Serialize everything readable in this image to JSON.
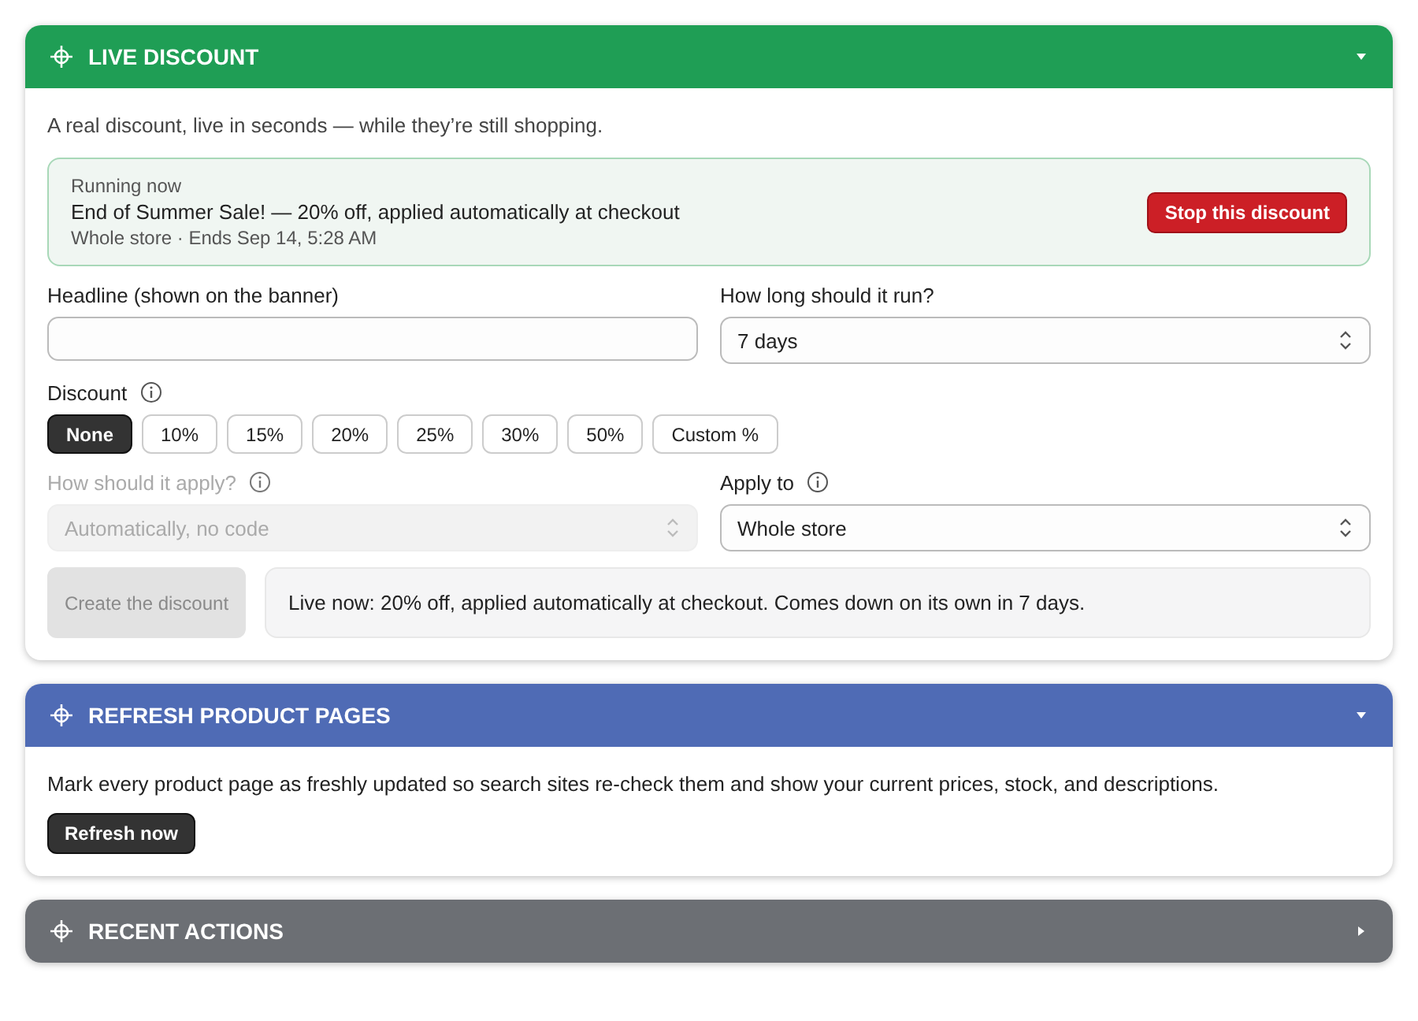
{
  "panels": [
    {
      "kind": "discount",
      "title": "LIVE DISCOUNT",
      "color": "#1f9e55",
      "expanded": true,
      "intro": "A real discount, live in seconds — while they’re still shopping.",
      "running": {
        "label": "Running now",
        "title": "End of Summer Sale! — 20% off, applied automatically at checkout",
        "meta": "Whole store · Ends Sep 14, 5:28 AM",
        "button": "Stop this discount"
      },
      "headline_field": {
        "label": "Headline (shown on the banner)"
      },
      "duration_field": {
        "label": "How long should it run?",
        "value": "7 days",
        "disabled": false
      },
      "discount": {
        "label": "Discount",
        "options": [
          {
            "label": "None",
            "selected": true
          },
          {
            "label": "10%",
            "selected": false
          },
          {
            "label": "15%",
            "selected": false
          },
          {
            "label": "20%",
            "selected": false
          },
          {
            "label": "25%",
            "selected": false
          },
          {
            "label": "30%",
            "selected": false
          },
          {
            "label": "50%",
            "selected": false
          },
          {
            "label": "Custom %",
            "selected": false
          }
        ]
      },
      "apply_method": {
        "label": "How should it apply?",
        "value": "Automatically, no code",
        "disabled": true
      },
      "apply_to": {
        "label": "Apply to",
        "value": "Whole store",
        "disabled": false
      },
      "create_button": {
        "label": "Create the discount",
        "disabled": true
      },
      "summary": "Live now: 20% off, applied automatically at checkout. Comes down on its own in 7 days."
    },
    {
      "kind": "refresh",
      "title": "REFRESH PRODUCT PAGES",
      "color": "#4f6bb5",
      "expanded": true,
      "description": "Mark every product page as freshly updated so search sites re-check them and show your current prices, stock, and descriptions.",
      "button": "Refresh now"
    },
    {
      "kind": "recent",
      "title": "RECENT ACTIONS",
      "color": "#6c6f74",
      "expanded": false
    }
  ]
}
